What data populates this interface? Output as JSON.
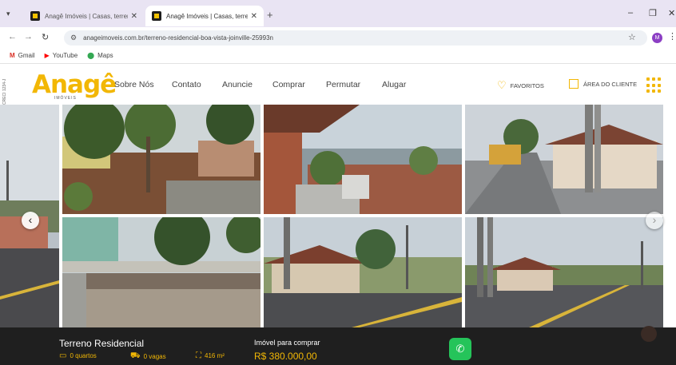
{
  "browser": {
    "tabs": [
      {
        "title": "Anagê Imóveis | Casas, terreno",
        "active": false
      },
      {
        "title": "Anagê Imóveis | Casas, terreno",
        "active": true
      }
    ],
    "url": "anageimoveis.com.br/terreno-residencial-boa-vista-joinville-25993n",
    "profile_initial": "M",
    "bookmarks": [
      {
        "label": "Gmail",
        "icon": "gmail-icon"
      },
      {
        "label": "YouTube",
        "icon": "youtube-icon"
      },
      {
        "label": "Maps",
        "icon": "maps-icon"
      }
    ]
  },
  "site": {
    "side_tag": "CRECI 1234-J",
    "logo_text": "Anagê",
    "logo_sub": "IMÓVEIS",
    "nav": [
      "Sobre Nós",
      "Contato",
      "Anuncie",
      "Comprar",
      "Permutar",
      "Alugar"
    ],
    "favorites_label": "FAVORITOS",
    "client_area_label": "ÁREA DO CLIENTE"
  },
  "listing": {
    "title": "Terreno Residencial",
    "features": [
      {
        "icon": "bed-icon",
        "label": "0 quartos"
      },
      {
        "icon": "car-icon",
        "label": "0 vagas"
      },
      {
        "icon": "area-icon",
        "label": "416 m²"
      }
    ],
    "price_label": "Imóvel para comprar",
    "price": "R$ 380.000,00"
  },
  "colors": {
    "accent": "#f2b705",
    "bar": "#1f1f1f",
    "whatsapp": "#25c45a"
  }
}
